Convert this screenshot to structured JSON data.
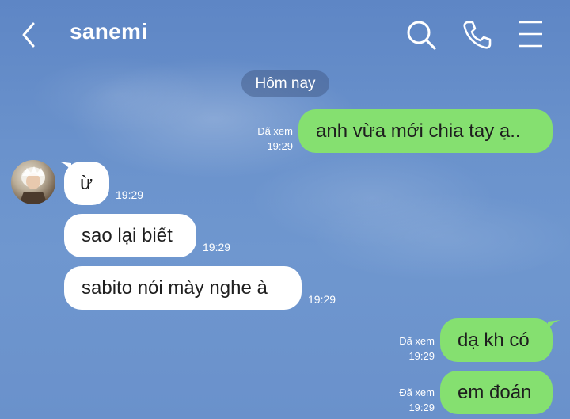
{
  "header": {
    "title": "sanemi"
  },
  "date_divider": "Hôm nay",
  "messages": [
    {
      "direction": "outgoing",
      "text": "anh vừa mới chia tay ạ..",
      "read_status": "Đã xem",
      "time": "19:29"
    },
    {
      "direction": "incoming",
      "text": "ừ",
      "time": "19:29"
    },
    {
      "direction": "incoming",
      "text": "sao lại biết",
      "time": "19:29"
    },
    {
      "direction": "incoming",
      "text": "sabito nói mày nghe à",
      "time": "19:29"
    },
    {
      "direction": "outgoing",
      "text": "dạ kh có",
      "read_status": "Đã xem",
      "time": "19:29"
    },
    {
      "direction": "outgoing",
      "text": "em đoán",
      "read_status": "Đã xem",
      "time": "19:29"
    }
  ],
  "colors": {
    "background": "#6a91cb",
    "outgoing_bubble": "#85e070",
    "incoming_bubble": "#ffffff",
    "header_text": "#ffffff"
  },
  "icons": [
    "back-arrow-icon",
    "search-icon",
    "phone-icon",
    "menu-icon",
    "avatar"
  ]
}
